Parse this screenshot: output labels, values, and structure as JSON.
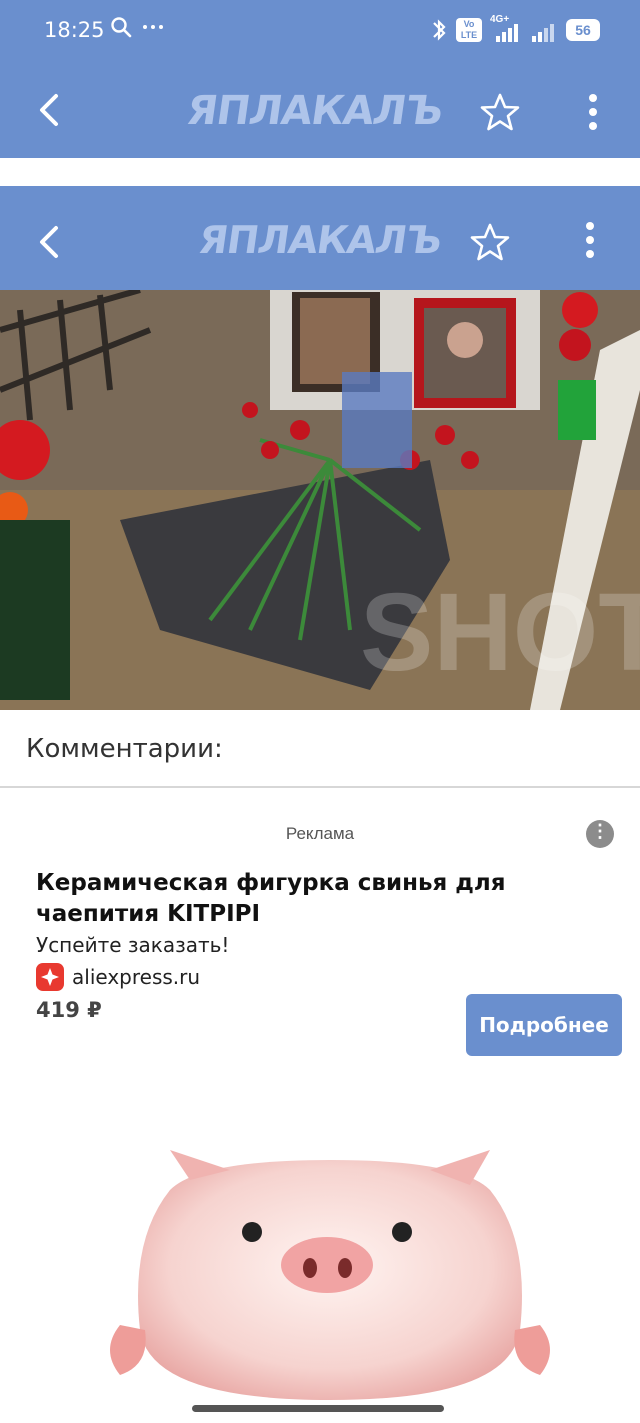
{
  "status_bar": {
    "time": "18:25",
    "battery": "56",
    "network": "4G+",
    "volte": "Vo LTE"
  },
  "app_bar_top": {
    "logo": "ЯПЛАКАЛЪ"
  },
  "app_bar_inner": {
    "logo": "ЯПЛАКАЛЪ"
  },
  "post_image": {
    "watermark": "SHOT"
  },
  "comments": {
    "title": "Комментарии:"
  },
  "ad": {
    "label": "Реклама",
    "title": "Керамическая фигурка свинья для чаепития KITPIPI",
    "subtitle": "Успейте заказать!",
    "source": "aliexpress.ru",
    "price": "419 ₽",
    "button": "Подробнее"
  },
  "colors": {
    "accent": "#6a8fce",
    "logo": "#aec4ea",
    "aliexpress": "#e8392f"
  }
}
